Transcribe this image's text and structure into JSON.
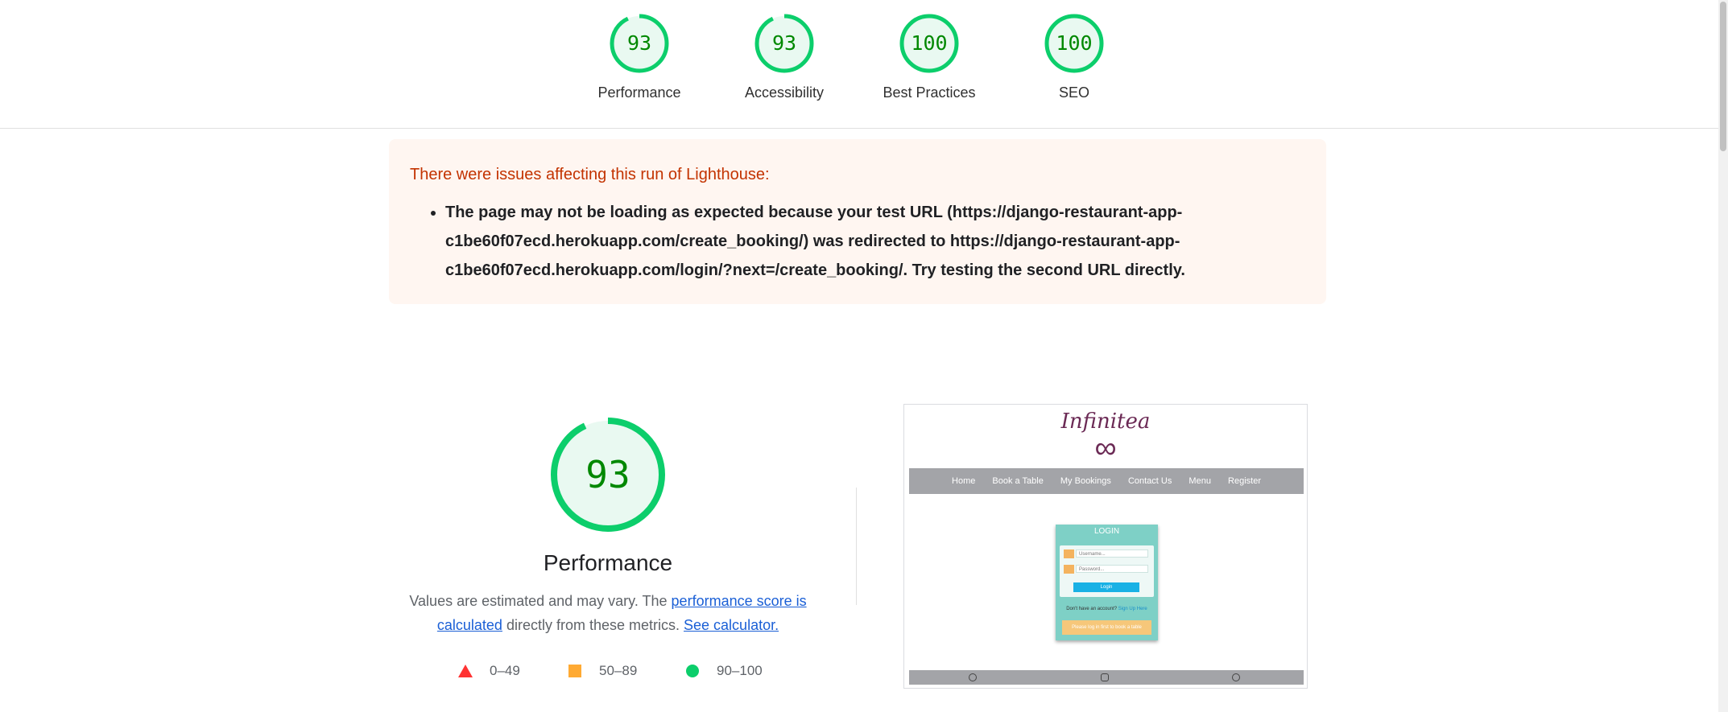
{
  "scores": [
    {
      "label": "Performance",
      "value": "93",
      "fraction": 0.93,
      "color": "#0cce6b"
    },
    {
      "label": "Accessibility",
      "value": "93",
      "fraction": 0.93,
      "color": "#0cce6b"
    },
    {
      "label": "Best Practices",
      "value": "100",
      "fraction": 1.0,
      "color": "#0cce6b"
    },
    {
      "label": "SEO",
      "value": "100",
      "fraction": 1.0,
      "color": "#0cce6b"
    }
  ],
  "warning": {
    "title": "There were issues affecting this run of Lighthouse:",
    "message": "The page may not be loading as expected because your test URL (https://django-restaurant-app-c1be60f07ecd.herokuapp.com/create_booking/) was redirected to https://django-restaurant-app-c1be60f07ecd.herokuapp.com/login/?next=/create_booking/. Try testing the second URL directly."
  },
  "performance": {
    "score": "93",
    "fraction": 0.93,
    "title": "Performance",
    "desc_prefix": "Values are estimated and may vary. The ",
    "link_score": "performance score is calculated",
    "desc_middle": " directly from these metrics. ",
    "link_calculator": "See calculator."
  },
  "legend": [
    {
      "range": "0–49",
      "shape": "triangle",
      "color": "#ff3333"
    },
    {
      "range": "50–89",
      "shape": "square",
      "color": "#ffaa33"
    },
    {
      "range": "90–100",
      "shape": "circle",
      "color": "#0cce6b"
    }
  ],
  "screenshot": {
    "brand": "Infinitea",
    "logo_symbol": "∞",
    "nav": [
      "Home",
      "Book a Table",
      "My Bookings",
      "Contact Us",
      "Menu",
      "Register"
    ],
    "login_title": "LOGIN",
    "username_placeholder": "Username...",
    "password_placeholder": "Password...",
    "login_button": "Login",
    "signup_text": "Don't have an account?",
    "signup_link": "Sign Up Here",
    "alert_text": "Please log in first to book a table"
  }
}
